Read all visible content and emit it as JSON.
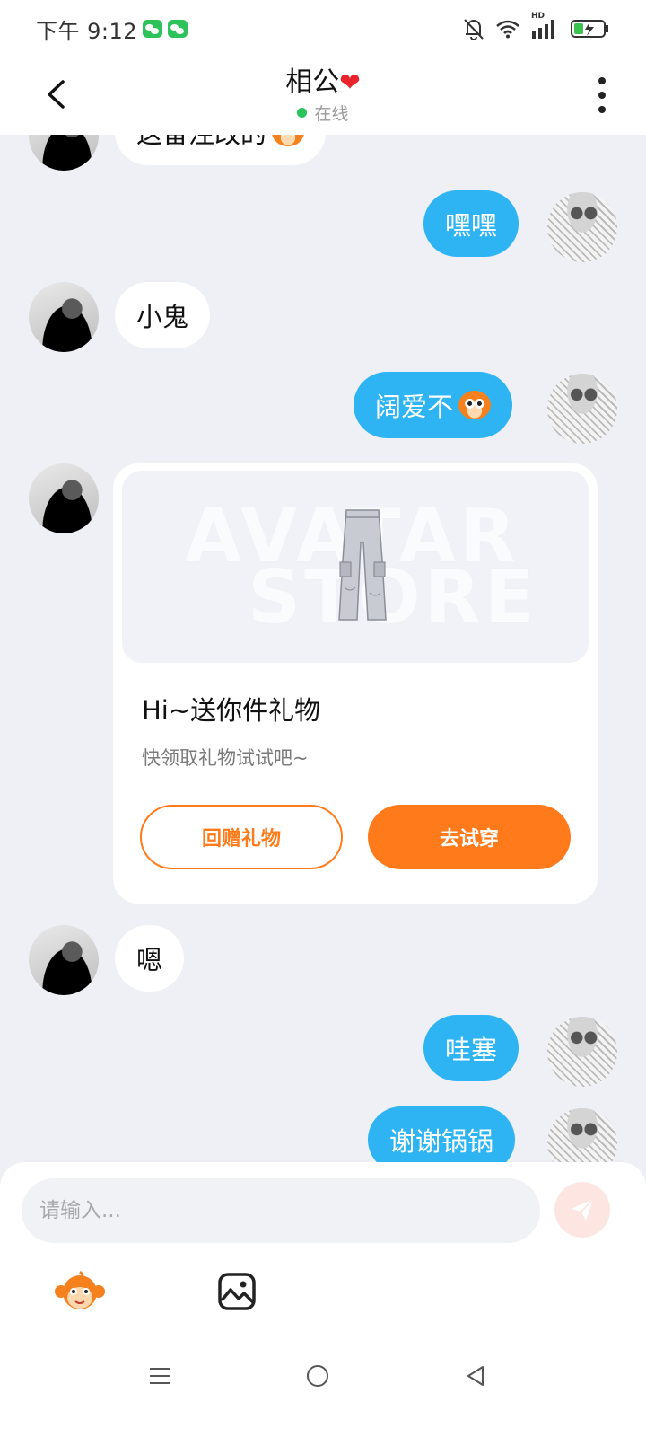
{
  "status_bar": {
    "time": "下午 9:12",
    "icons": [
      "wechat-icon",
      "wechat-icon",
      "mute-bell-icon",
      "wifi-icon",
      "signal-icon",
      "battery-charging-icon"
    ],
    "signal_tag": "HD"
  },
  "header": {
    "title": "相公",
    "heart": "❤",
    "status": "在线",
    "status_color": "#29c35c"
  },
  "messages": [
    {
      "from": "peer",
      "text": "这备注改的",
      "emoji": "monkey-emoji"
    },
    {
      "from": "self",
      "text": "嘿嘿"
    },
    {
      "from": "peer",
      "text": "小鬼"
    },
    {
      "from": "self",
      "text": "阔爱不",
      "emoji": "monkey-emoji"
    },
    {
      "from": "peer",
      "type": "gift"
    },
    {
      "from": "peer",
      "text": "嗯"
    },
    {
      "from": "self",
      "text": "哇塞"
    },
    {
      "from": "self",
      "text": "谢谢锅锅"
    }
  ],
  "gift_card": {
    "watermark_line1": "AVATAR",
    "watermark_line2": "STORE",
    "title": "Hi~送你件礼物",
    "subtitle": "快领取礼物试试吧~",
    "return_button": "回赠礼物",
    "try_button": "去试穿",
    "accent": "#ff7a1a"
  },
  "composer": {
    "placeholder": "请输入...",
    "send_icon": "paper-plane-icon",
    "tools": [
      "monkey-sticker-icon",
      "image-icon"
    ]
  },
  "colors": {
    "self_bubble": "#2fb4f3",
    "background": "#eef0f6"
  },
  "nav_bar": [
    "menu-icon",
    "home-icon",
    "back-icon"
  ]
}
